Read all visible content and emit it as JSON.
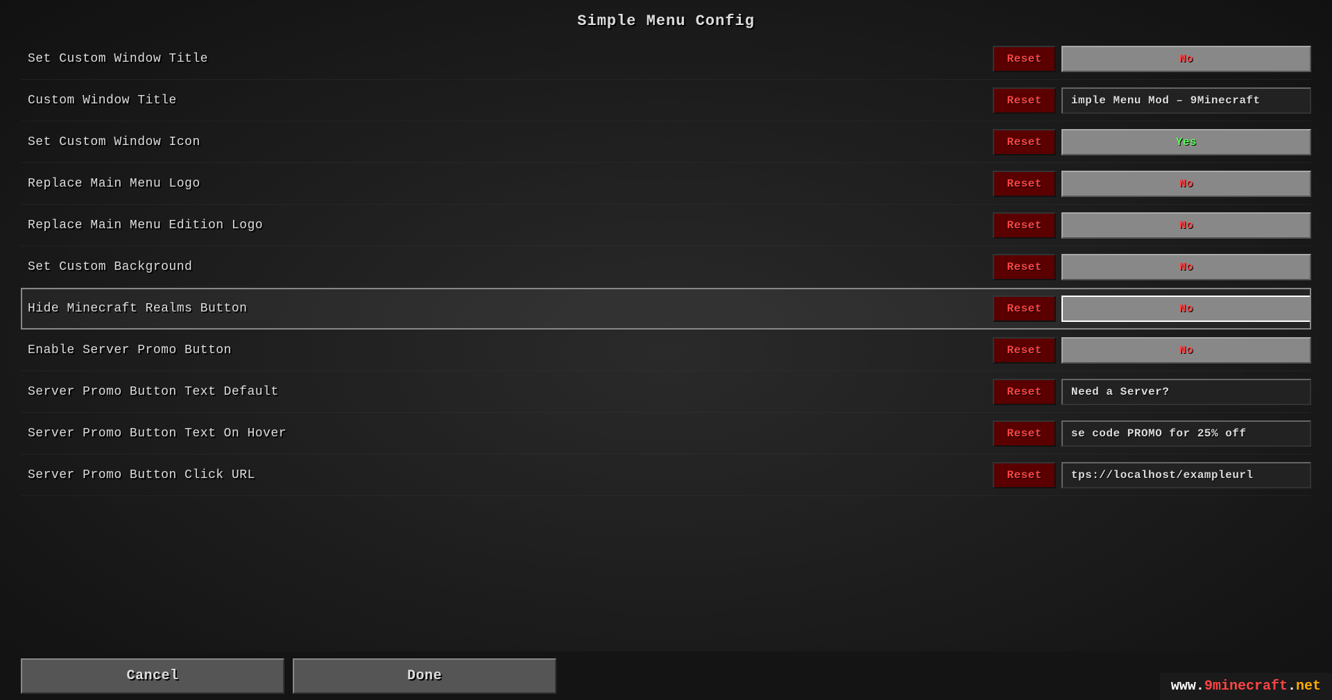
{
  "page": {
    "title": "Simple Menu Config"
  },
  "rows": [
    {
      "id": "set-custom-window-title",
      "label": "Set Custom Window Title",
      "value": "No",
      "valueType": "toggle",
      "highlighted": false
    },
    {
      "id": "custom-window-title",
      "label": "Custom Window Title",
      "value": "imple Menu Mod – 9Minecraft",
      "valueType": "text",
      "highlighted": false
    },
    {
      "id": "set-custom-window-icon",
      "label": "Set Custom Window Icon",
      "value": "Yes",
      "valueType": "yes",
      "highlighted": false
    },
    {
      "id": "replace-main-menu-logo",
      "label": "Replace Main Menu Logo",
      "value": "No",
      "valueType": "toggle",
      "highlighted": false
    },
    {
      "id": "replace-main-menu-edition-logo",
      "label": "Replace Main Menu Edition Logo",
      "value": "No",
      "valueType": "toggle",
      "highlighted": false
    },
    {
      "id": "set-custom-background",
      "label": "Set Custom Background",
      "value": "No",
      "valueType": "toggle",
      "highlighted": false
    },
    {
      "id": "hide-minecraft-realms-button",
      "label": "Hide Minecraft Realms Button",
      "value": "No",
      "valueType": "toggle",
      "highlighted": true
    },
    {
      "id": "enable-server-promo-button",
      "label": "Enable Server Promo Button",
      "value": "No",
      "valueType": "toggle",
      "highlighted": false
    },
    {
      "id": "server-promo-button-text-default",
      "label": "Server Promo Button Text Default",
      "value": "Need a Server?",
      "valueType": "text",
      "highlighted": false
    },
    {
      "id": "server-promo-button-text-on-hover",
      "label": "Server Promo Button Text On Hover",
      "value": "se code PROMO for 25% off",
      "valueType": "text",
      "highlighted": false
    },
    {
      "id": "server-promo-button-click-url",
      "label": "Server Promo Button Click URL",
      "value": "tps://localhost/exampleurl",
      "valueType": "text",
      "highlighted": false
    }
  ],
  "buttons": {
    "reset": "Reset",
    "cancel": "Cancel",
    "done": "Done"
  },
  "watermark": {
    "www": "www.",
    "nine": "9",
    "mine": "minecraft",
    "dot": ".",
    "net": "net"
  }
}
